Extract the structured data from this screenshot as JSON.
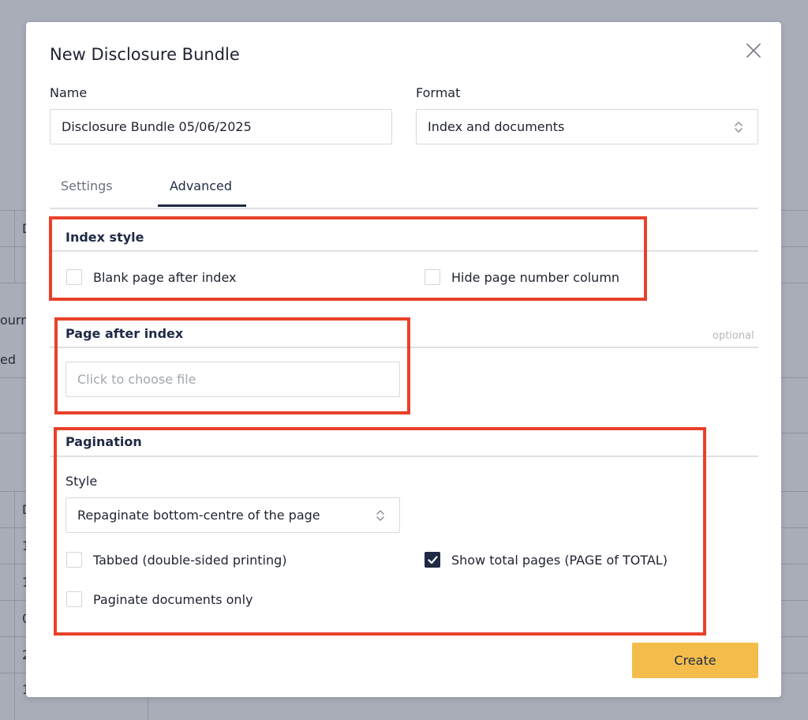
{
  "background": {
    "fragments": [
      "D",
      "ourn",
      "ed",
      "D",
      "1",
      "1",
      "0",
      "2",
      "1"
    ]
  },
  "dialog": {
    "title": "New Disclosure Bundle",
    "close_icon": "close-icon"
  },
  "name_field": {
    "label": "Name",
    "value": "Disclosure Bundle 05/06/2025"
  },
  "format_field": {
    "label": "Format",
    "selected": "Index and documents",
    "icon": "updown-chevron-icon"
  },
  "tabs": [
    {
      "label": "Settings",
      "active": false
    },
    {
      "label": "Advanced",
      "active": true
    }
  ],
  "index_style": {
    "title": "Index style",
    "options": [
      {
        "label": "Blank page after index",
        "checked": false
      },
      {
        "label": "Hide page number column",
        "checked": false
      }
    ]
  },
  "page_after_index": {
    "title": "Page after index",
    "optional": "optional",
    "placeholder": "Click to choose file"
  },
  "pagination": {
    "title": "Pagination",
    "style_label": "Style",
    "style_selected": "Repaginate bottom-centre of the page",
    "options": [
      {
        "label": "Tabbed (double-sided printing)",
        "checked": false
      },
      {
        "label": "Show total pages (PAGE of TOTAL)",
        "checked": true
      },
      {
        "label": "Paginate documents only",
        "checked": false
      }
    ]
  },
  "actions": {
    "create_label": "Create"
  },
  "colors": {
    "accent": "#f4bd4b",
    "highlight": "#e8412a",
    "navy": "#1f2a44"
  }
}
